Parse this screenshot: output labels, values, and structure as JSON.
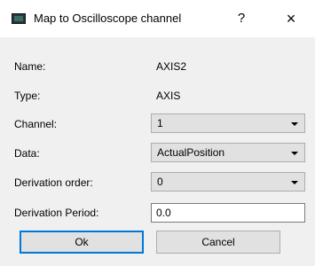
{
  "window": {
    "title": "Map to Oscilloscope channel",
    "help_symbol": "?",
    "close_symbol": "×",
    "app_icon": "oscilloscope-icon"
  },
  "form": {
    "name": {
      "label": "Name:",
      "value": "AXIS2"
    },
    "type": {
      "label": "Type:",
      "value": "AXIS"
    },
    "channel": {
      "label": "Channel:",
      "value": "1"
    },
    "data": {
      "label": "Data:",
      "value": "ActualPosition"
    },
    "derivation_order": {
      "label": "Derivation order:",
      "value": "0"
    },
    "derivation_period": {
      "label": "Derivation Period:",
      "value": "0.0"
    }
  },
  "buttons": {
    "ok": "Ok",
    "cancel": "Cancel"
  },
  "colors": {
    "titlebar": "#ffffff",
    "dialog_bg": "#f0f0f0",
    "default_button_border": "#0078d7"
  }
}
